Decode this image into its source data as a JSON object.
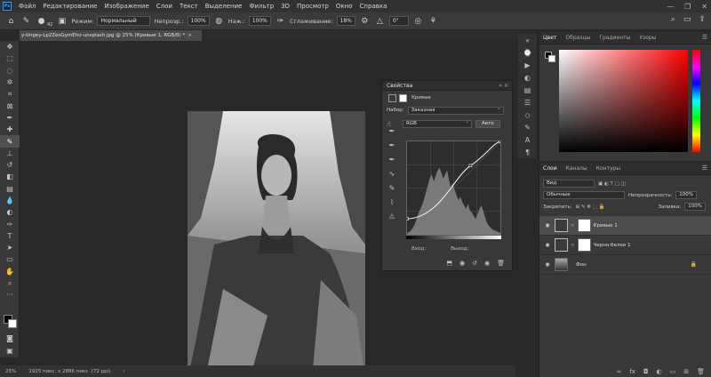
{
  "menu": [
    "Файл",
    "Редактирование",
    "Изображение",
    "Слои",
    "Текст",
    "Выделение",
    "Фильтр",
    "3D",
    "Просмотр",
    "Окно",
    "Справка"
  ],
  "options": {
    "brush_size": "42",
    "mode_label": "Режим:",
    "mode_value": "Нормальный",
    "opacity_label": "Непрозр.:",
    "opacity_value": "100%",
    "pressure_label": "Наж.:",
    "pressure_value": "100%",
    "smoothing_label": "Сглаживание:",
    "smoothing_value": "18%",
    "angle_value": "0°"
  },
  "document": {
    "tab_title": "y-tingey-Lp2ZesGymEho-unsplash.jpg @ 25% (Кривые 1, RGB/8) *",
    "close": "×"
  },
  "status": {
    "zoom": "25%",
    "size": "1925 пикс. x 2886 пикс. (72 ppi)",
    "arrow": "›"
  },
  "properties": {
    "title": "Свойства",
    "collapse": "«",
    "close": "×",
    "subtitle": "Кривые",
    "preset_label": "Набор:",
    "preset_value": "Заказная",
    "channel_value": "RGB",
    "auto_label": "Авто",
    "input_label": "Вход:",
    "output_label": "Выход:"
  },
  "color_panel": {
    "tabs": [
      "Цвет",
      "Образцы",
      "Градиенты",
      "Узоры"
    ],
    "fg_color": "#000000",
    "bg_color": "#ffffff",
    "hue_color": "#ff0000"
  },
  "layers_panel": {
    "tabs": [
      "Слои",
      "Каналы",
      "Контуры"
    ],
    "filter_value": "Вид",
    "blend_value": "Обычные",
    "opacity_label": "Непрозрачность:",
    "opacity_value": "100%",
    "lock_label": "Закрепить:",
    "fill_label": "Заливка:",
    "fill_value": "100%",
    "layers": [
      {
        "name": "Кривые 1",
        "active": true
      },
      {
        "name": "Черно-белое 1",
        "active": false
      },
      {
        "name": "Фон",
        "active": false
      }
    ],
    "footer": "fx"
  },
  "curves": {
    "histogram": [
      2,
      3,
      5,
      8,
      12,
      18,
      25,
      30,
      35,
      42,
      50,
      58,
      66,
      70,
      62,
      68,
      74,
      78,
      72,
      65,
      70,
      75,
      64,
      55,
      60,
      52,
      46,
      40,
      44,
      38,
      34,
      30,
      36,
      28,
      26,
      22,
      18,
      24,
      30,
      34,
      28,
      20,
      14,
      10,
      8,
      6,
      5,
      4,
      3,
      2
    ],
    "points": [
      [
        0,
        0.17
      ],
      [
        0.68,
        0.74
      ],
      [
        1,
        1
      ]
    ]
  }
}
